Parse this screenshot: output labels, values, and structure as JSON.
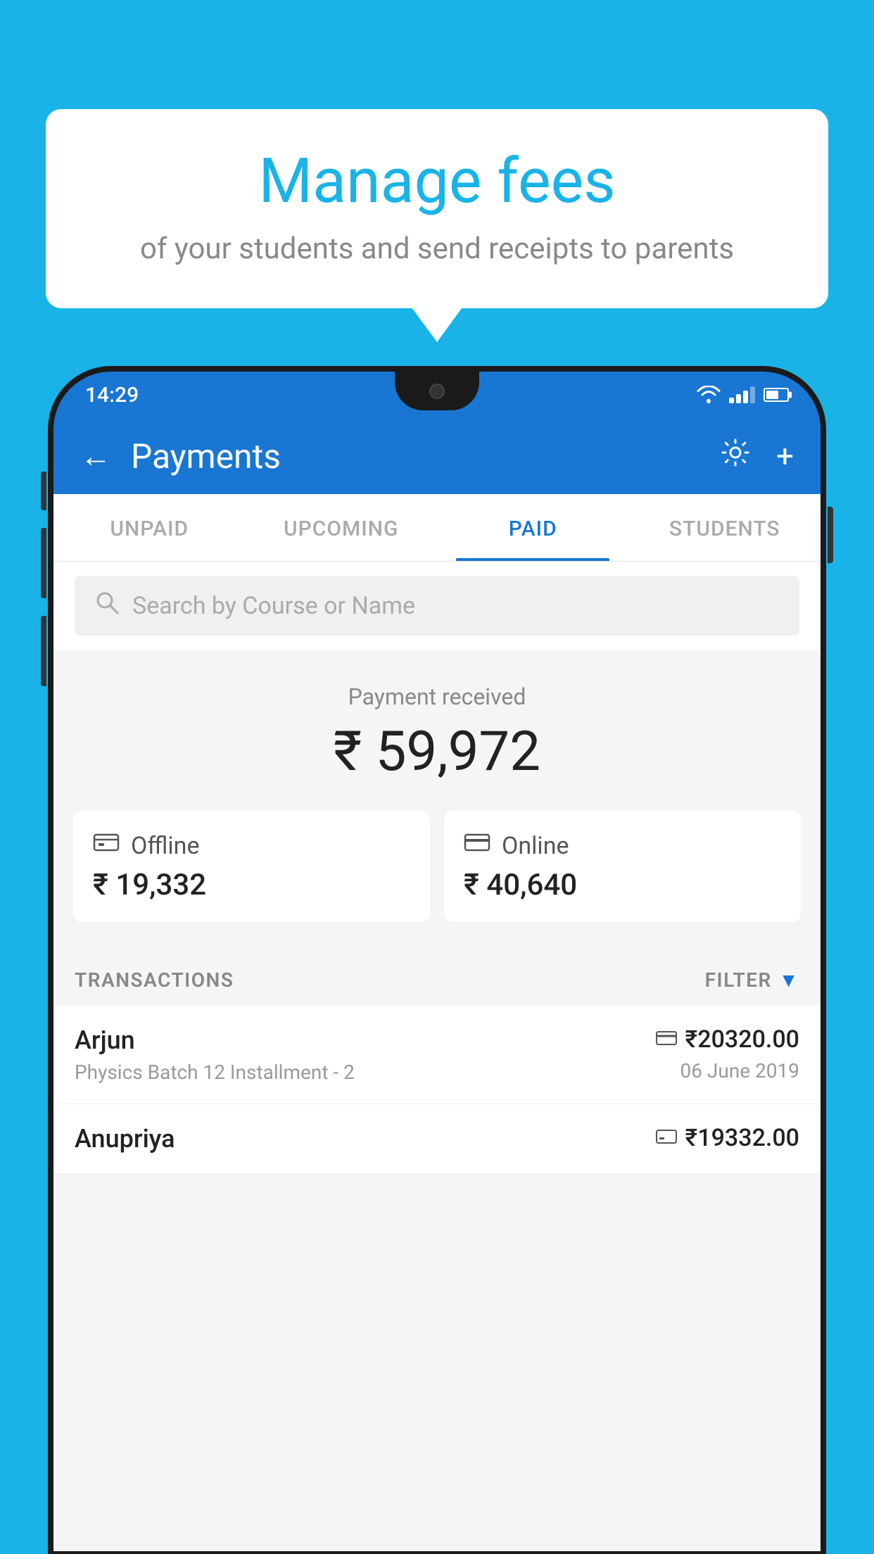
{
  "background_color": "#1ab3e8",
  "speech_bubble": {
    "title": "Manage fees",
    "subtitle": "of your students and send receipts to parents"
  },
  "status_bar": {
    "time": "14:29"
  },
  "header": {
    "title": "Payments",
    "back_label": "←",
    "gear_label": "⚙",
    "plus_label": "+"
  },
  "tabs": [
    {
      "label": "UNPAID",
      "active": false
    },
    {
      "label": "UPCOMING",
      "active": false
    },
    {
      "label": "PAID",
      "active": true
    },
    {
      "label": "STUDENTS",
      "active": false
    }
  ],
  "search": {
    "placeholder": "Search by Course or Name"
  },
  "payment_summary": {
    "label": "Payment received",
    "amount": "₹ 59,972"
  },
  "payment_cards": [
    {
      "label": "Offline",
      "amount": "₹ 19,332",
      "icon": "💳"
    },
    {
      "label": "Online",
      "amount": "₹ 40,640",
      "icon": "💳"
    }
  ],
  "transactions_section": {
    "label": "TRANSACTIONS",
    "filter_label": "FILTER"
  },
  "transactions": [
    {
      "name": "Arjun",
      "detail": "Physics Batch 12 Installment - 2",
      "amount": "₹20320.00",
      "date": "06 June 2019",
      "payment_type": "online"
    },
    {
      "name": "Anupriya",
      "detail": "",
      "amount": "₹19332.00",
      "date": "",
      "payment_type": "offline"
    }
  ]
}
